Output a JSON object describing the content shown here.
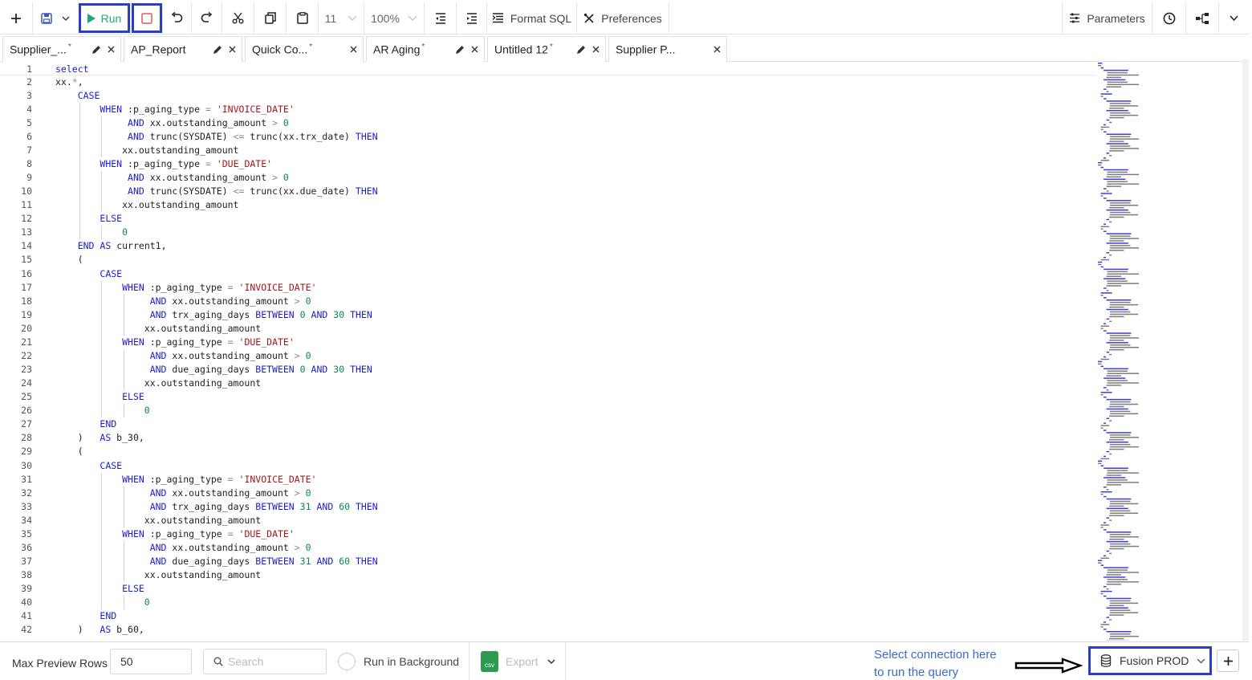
{
  "toolbar": {
    "run_label": "Run",
    "font_size": "11",
    "zoom": "100%",
    "format_sql_label": "Format SQL",
    "preferences_label": "Preferences",
    "parameters_label": "Parameters"
  },
  "tabs": [
    {
      "name": "Supplier_...",
      "modified": "*",
      "editable": true,
      "active": false
    },
    {
      "name": "AP_Report",
      "modified": "",
      "editable": true,
      "active": false
    },
    {
      "name": "Quick Co...",
      "modified": "*",
      "editable": false,
      "active": false
    },
    {
      "name": "AR Aging",
      "modified": "*",
      "editable": true,
      "active": true
    },
    {
      "name": "Untitled 12",
      "modified": "*",
      "editable": true,
      "active": false
    },
    {
      "name": "Supplier P...",
      "modified": "",
      "editable": false,
      "active": false
    }
  ],
  "editor": {
    "current_line": 1,
    "lines": [
      "select",
      "xx.*,",
      "    CASE",
      "        WHEN :p_aging_type = 'INVOICE_DATE'",
      "             AND xx.outstanding_amount > 0",
      "             AND trunc(SYSDATE) <= trunc(xx.trx_date) THEN",
      "            xx.outstanding_amount",
      "        WHEN :p_aging_type = 'DUE_DATE'",
      "             AND xx.outstanding_amount > 0",
      "             AND trunc(SYSDATE) <= trunc(xx.due_date) THEN",
      "            xx.outstanding_amount",
      "        ELSE",
      "            0",
      "    END AS current1,",
      "    (",
      "        CASE",
      "            WHEN :p_aging_type = 'INVOICE_DATE'",
      "                 AND xx.outstanding_amount > 0",
      "                 AND trx_aging_days BETWEEN 0 AND 30 THEN",
      "                xx.outstanding_amount",
      "            WHEN :p_aging_type = 'DUE_DATE'",
      "                 AND xx.outstanding_amount > 0",
      "                 AND due_aging_days BETWEEN 0 AND 30 THEN",
      "                xx.outstanding_amount",
      "            ELSE",
      "                0",
      "        END",
      "    )   AS b_30,",
      "    (",
      "        CASE",
      "            WHEN :p_aging_type = 'INVOICE_DATE'",
      "                 AND xx.outstanding_amount > 0",
      "                 AND trx_aging_days BETWEEN 31 AND 60 THEN",
      "                xx.outstanding_amount",
      "            WHEN :p_aging_type = 'DUE_DATE'",
      "                 AND xx.outstanding_amount > 0",
      "                 AND due_aging_days BETWEEN 31 AND 60 THEN",
      "                xx.outstanding_amount",
      "            ELSE",
      "                0",
      "        END",
      "    )   AS b_60,"
    ]
  },
  "footer": {
    "max_preview_label": "Max Preview Rows",
    "max_preview_value": "50",
    "search_placeholder": "Search",
    "run_background_label": "Run in Background",
    "csv_badge": "csv",
    "export_label": "Export",
    "annotation_line1": "Select connection here",
    "annotation_line2": "to run the query",
    "connection": "Fusion PROD"
  },
  "colors": {
    "keyword": "#1b1bd0",
    "string": "#a3151a",
    "number": "#098658",
    "run_green": "#1fa97b",
    "highlight_box": "#2a3ec2",
    "annotation_text": "#3a6cc8"
  }
}
